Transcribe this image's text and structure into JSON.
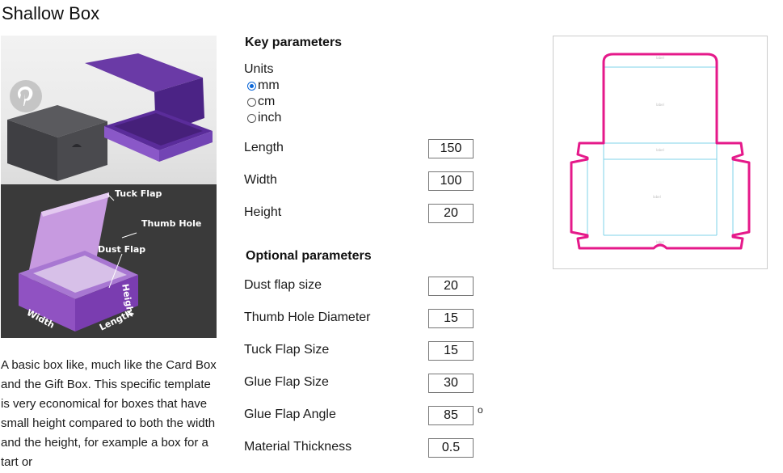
{
  "page": {
    "title": "Shallow Box"
  },
  "photo": {
    "pinterest_icon": "pinterest-icon"
  },
  "diagram": {
    "labels": {
      "tuck_flap": "Tuck Flap",
      "thumb_hole": "Thumb Hole",
      "dust_flap": "Dust Flap",
      "height": "Height",
      "width": "Width",
      "length": "Length"
    }
  },
  "description": "A basic box like, much like the Card Box and the Gift Box. This specific template is very economical for boxes that have small height compared to both the width and the height, for example a box for a tart or",
  "key_parameters": {
    "title": "Key parameters",
    "units_label": "Units",
    "units": [
      {
        "label": "mm",
        "checked": true
      },
      {
        "label": "cm",
        "checked": false
      },
      {
        "label": "inch",
        "checked": false
      }
    ],
    "length": {
      "label": "Length",
      "value": "150"
    },
    "width": {
      "label": "Width",
      "value": "100"
    },
    "height": {
      "label": "Height",
      "value": "20"
    }
  },
  "optional_parameters": {
    "title": "Optional parameters",
    "dust_flap": {
      "label": "Dust flap size",
      "value": "20"
    },
    "thumb_hole": {
      "label": "Thumb Hole Diameter",
      "value": "15"
    },
    "tuck_flap": {
      "label": "Tuck Flap Size",
      "value": "15"
    },
    "glue_flap": {
      "label": "Glue Flap Size",
      "value": "30"
    },
    "glue_flap_angle": {
      "label": "Glue Flap Angle",
      "value": "85",
      "unit": "o"
    },
    "material_thickness": {
      "label": "Material Thickness",
      "value": "0.5"
    }
  },
  "colors": {
    "cut_line": "#e5198a",
    "fold_line": "#7fd3e8",
    "radio_accent": "#0a66d8"
  }
}
